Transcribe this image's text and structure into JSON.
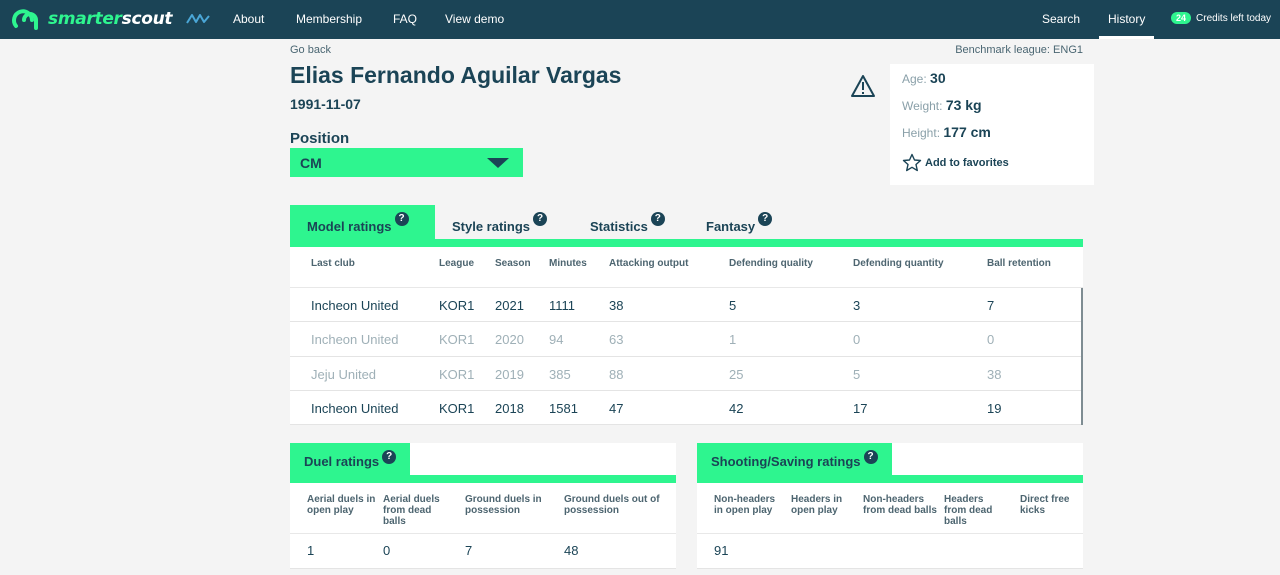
{
  "nav": {
    "logo_part1": "smarter",
    "logo_part2": "scout",
    "links": [
      "About",
      "Membership",
      "FAQ",
      "View demo"
    ],
    "search": "Search",
    "history": "History",
    "credits_count": "24",
    "credits_label": "Credits left today"
  },
  "header": {
    "go_back": "Go back",
    "benchmark": "Benchmark league: ENG1",
    "name": "Elias Fernando Aguilar Vargas",
    "dob": "1991-11-07",
    "position_label": "Position",
    "position_value": "CM"
  },
  "info": {
    "age_label": "Age:",
    "age": "30",
    "weight_label": "Weight:",
    "weight": "73 kg",
    "height_label": "Height:",
    "height": "177 cm",
    "favorites": "Add to favorites"
  },
  "tabs": [
    "Model ratings",
    "Style ratings",
    "Statistics",
    "Fantasy"
  ],
  "help_glyph": "?",
  "model_table": {
    "columns": [
      "Last club",
      "League",
      "Season",
      "Minutes",
      "Attacking output",
      "Defending quality",
      "Defending quantity",
      "Ball retention"
    ],
    "rows": [
      [
        "Incheon United",
        "KOR1",
        "2021",
        "1111",
        "38",
        "5",
        "3",
        "7"
      ],
      [
        "Incheon United",
        "KOR1",
        "2020",
        "94",
        "63",
        "1",
        "0",
        "0"
      ],
      [
        "Jeju United",
        "KOR1",
        "2019",
        "385",
        "88",
        "25",
        "5",
        "38"
      ],
      [
        "Incheon United",
        "KOR1",
        "2018",
        "1581",
        "47",
        "42",
        "17",
        "19"
      ]
    ]
  },
  "duel": {
    "title": "Duel ratings",
    "columns": [
      "Aerial duels in open play",
      "Aerial duels from dead balls",
      "Ground duels in possession",
      "Ground duels out of possession"
    ],
    "values": [
      "1",
      "0",
      "7",
      "48"
    ]
  },
  "shooting": {
    "title": "Shooting/Saving ratings",
    "columns": [
      "Non-headers in open play",
      "Headers in open play",
      "Non-headers from dead balls",
      "Headers from dead balls",
      "Direct free kicks"
    ],
    "values": [
      "91",
      "",
      "",
      "",
      ""
    ]
  },
  "colors": {
    "navy": "#1b4456",
    "accent": "#2ef58f"
  }
}
